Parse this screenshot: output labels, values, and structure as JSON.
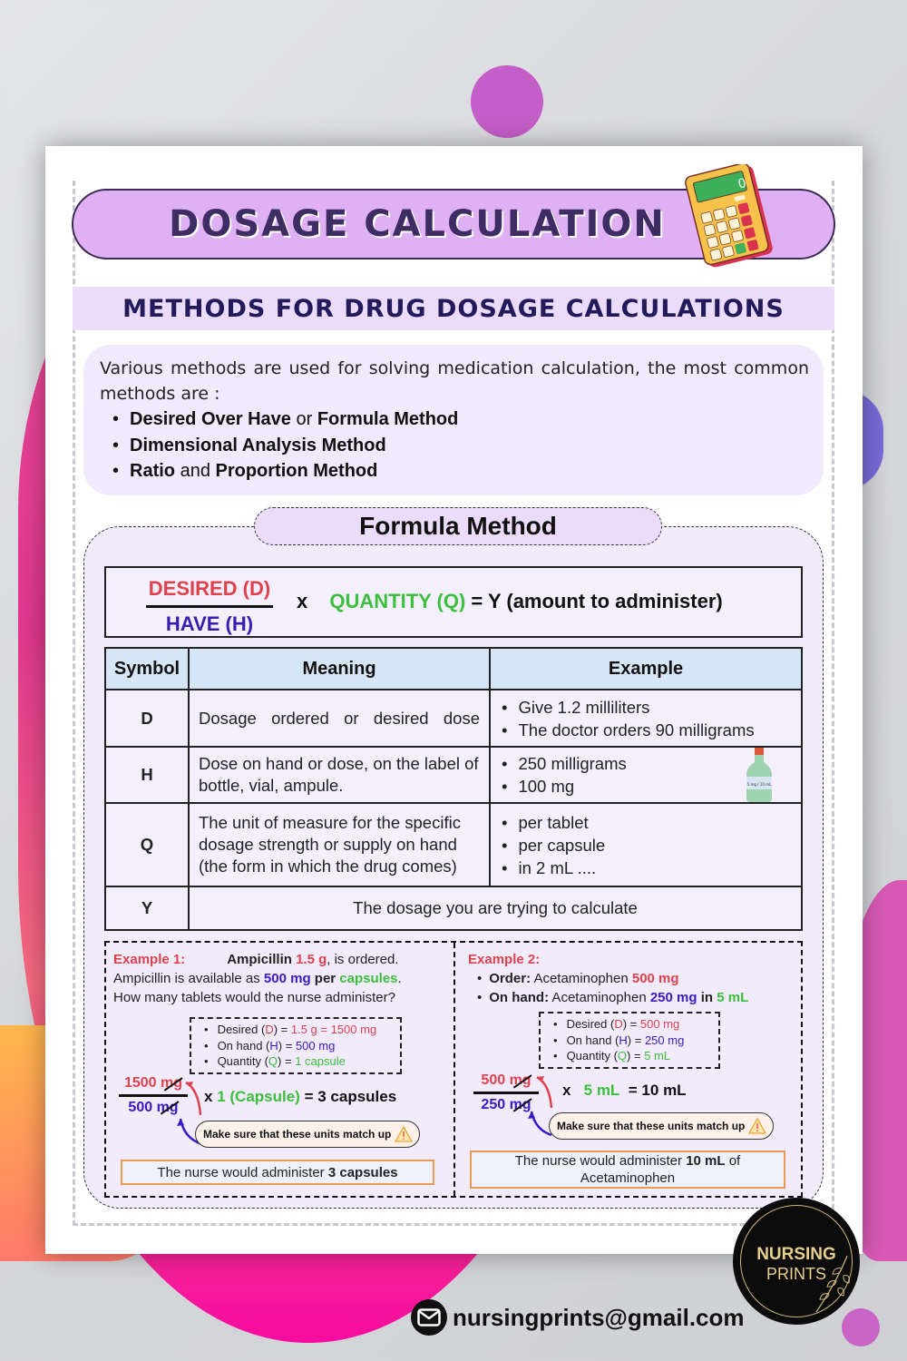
{
  "header": {
    "title": "DOSAGE CALCULATION",
    "subtitle": "METHODS FOR DRUG DOSAGE CALCULATIONS",
    "calculator_display": "0"
  },
  "intro": {
    "text": "Various methods are used for solving medication calculation,  the most common methods are :",
    "methods": [
      {
        "bold1": "Desired Over Have",
        "mid": " or ",
        "bold2": "Formula Method"
      },
      {
        "bold1": "Dimensional Analysis Method",
        "mid": "",
        "bold2": ""
      },
      {
        "bold1": "Ratio",
        "mid": " and ",
        "bold2": "Proportion Method"
      }
    ]
  },
  "formula": {
    "section_title": "Formula Method",
    "numerator": "DESIRED (D)",
    "denominator": "HAVE (H)",
    "times": "x",
    "quantity": "QUANTITY (Q)",
    "result": "=  Y (amount to administer)"
  },
  "table": {
    "headers": [
      "Symbol",
      "Meaning",
      "Example"
    ],
    "rows": [
      {
        "symbol": "D",
        "meaning": "Dosage ordered or desired dose",
        "examples": [
          "Give 1.2 milliliters",
          "The doctor orders 90 milligrams"
        ]
      },
      {
        "symbol": "H",
        "meaning": "Dose on hand or dose, on the label of bottle, vial, ampule.",
        "examples": [
          "250 milligrams",
          "100 mg"
        ],
        "bottle_label": "5 mg / 10 mL"
      },
      {
        "symbol": "Q",
        "meaning": "The unit of measure for the specific dosage strength or supply on hand (the form in which the drug comes)",
        "examples": [
          "per tablet",
          "per capsule",
          "in  2 mL ...."
        ]
      },
      {
        "symbol": "Y",
        "meaning": "The dosage you are trying to calculate"
      }
    ]
  },
  "example1": {
    "label": "Example 1:",
    "drug": "Ampicillin",
    "ordered_amount": "1.5 g",
    "ordered_suffix": ", is ordered.",
    "line2_prefix": "Ampicillin is available as ",
    "line2_amount": "500 mg",
    "line2_per": " per ",
    "line2_form": "capsules",
    "line2_end": ".",
    "question": "How many tablets would the nurse administer?",
    "given": [
      {
        "prefix": "Desired (",
        "sym": "D",
        "mid": ") = ",
        "value": "1.5 g = 1500 mg"
      },
      {
        "prefix": "On hand (",
        "sym": "H",
        "mid": ") = ",
        "value": "500 mg"
      },
      {
        "prefix": "Quantity (",
        "sym": "Q",
        "mid": ") = ",
        "value": "1 capsule"
      }
    ],
    "calc_num_value": "1500",
    "calc_den_value": "500",
    "calc_unit": "mg",
    "calc_times": "x",
    "calc_quantity": "1 (Capsule)",
    "calc_result": "=  3 capsules",
    "warning": "Make sure that these units match up",
    "answer_prefix": "The nurse would administer ",
    "answer_bold": "3 capsules",
    "answer_suffix": ""
  },
  "example2": {
    "label": "Example 2:",
    "order_label": "Order:",
    "order_text": " Acetaminophen ",
    "order_amount": "500 mg",
    "onhand_label": "On hand:",
    "onhand_text": " Acetaminophen ",
    "onhand_amount": "250 mg",
    "onhand_in": " in ",
    "onhand_volume": "5 mL",
    "given": [
      {
        "prefix": "Desired (",
        "sym": "D",
        "mid": ") = ",
        "value": "500 mg"
      },
      {
        "prefix": "On hand (",
        "sym": "H",
        "mid": ") = ",
        "value": "250 mg"
      },
      {
        "prefix": "Quantity (",
        "sym": "Q",
        "mid": ") = ",
        "value": "5 mL"
      }
    ],
    "calc_num_value": "500",
    "calc_den_value": "250",
    "calc_unit": "mg",
    "calc_times": "x",
    "calc_quantity": "5 mL",
    "calc_result": "=  10 mL",
    "warning": "Make sure that these units match up",
    "answer_prefix": "The nurse would administer ",
    "answer_bold": "10 mL",
    "answer_suffix": " of Acetaminophen"
  },
  "footer": {
    "email": "nursingprints@gmail.com",
    "logo_line1": "NURSING",
    "logo_line2": "PRINTS",
    "logo_ring_text": "NURSING PRINTS"
  },
  "colors": {
    "desired": "#e0424d",
    "have": "#3a19c6",
    "quantity": "#3cbf3c",
    "title_pill": "#e0b0f5",
    "title_text": "#3d2d63",
    "table_header": "#d6e6f6",
    "answer_border": "#ed9a52"
  }
}
